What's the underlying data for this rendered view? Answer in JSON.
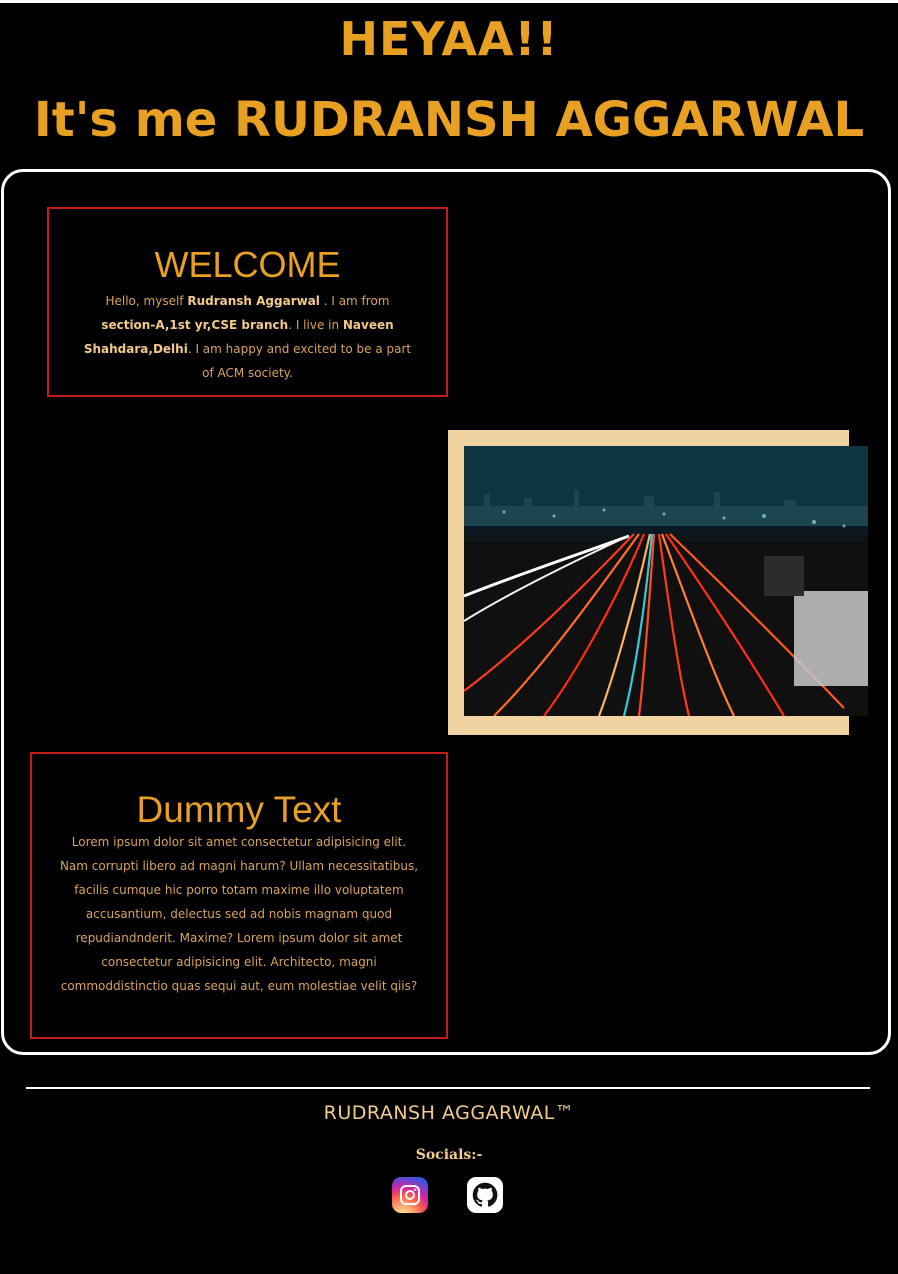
{
  "header": {
    "greeting": "HEYAA!!",
    "intro": "It's me RUDRANSH AGGARWAL"
  },
  "welcome": {
    "title": "WELCOME",
    "text_parts": {
      "p1": "Hello, myself ",
      "name": "Rudransh Aggarwal",
      "p2": " . I am from ",
      "section": "section-A,1st yr,CSE branch",
      "p3": ". I live in ",
      "place": "Naveen Shahdara,Delhi",
      "p4": ". I am happy and excited to be a part of ACM society."
    }
  },
  "dummy": {
    "title": "Dummy Text",
    "text": "Lorem ipsum dolor sit amet consectetur adipisicing elit. Nam corrupti libero ad magni harum? Ullam necessitatibus, facilis cumque hic porro totam maxime illo voluptatem accusantium, delectus sed ad nobis magnam quod repudiandnderit. Maxime? Lorem ipsum dolor sit amet consectetur adipisicing elit. Architecto, magni commoddistinctio quas sequi aut, eum molestiae velit qiis?"
  },
  "footer": {
    "name": "RUDRANSH AGGARWAL™",
    "socials_label": "Socials:-",
    "socials": [
      {
        "icon": "instagram-icon"
      },
      {
        "icon": "github-icon"
      }
    ]
  },
  "colors": {
    "accent": "#e8a023",
    "border": "#c41a1a",
    "background": "#000000"
  }
}
